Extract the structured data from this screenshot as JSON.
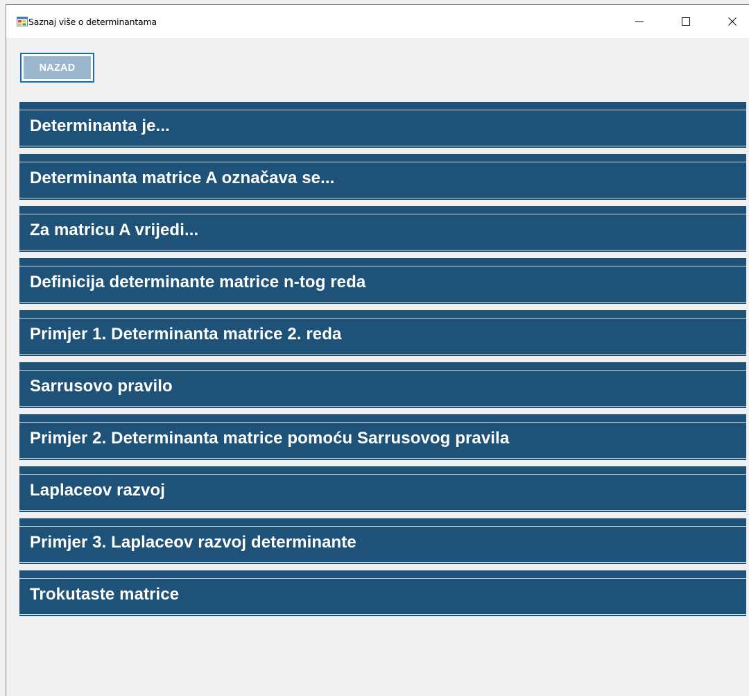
{
  "window": {
    "title": "Saznaj više o determinantama",
    "controls": {
      "minimize_icon": "minimize-icon",
      "maximize_icon": "maximize-icon",
      "close_icon": "close-icon"
    }
  },
  "toolbar": {
    "back_label": "NAZAD"
  },
  "topics": [
    {
      "label": "Determinanta je..."
    },
    {
      "label": "Determinanta matrice A označava se..."
    },
    {
      "label": "Za matricu A vrijedi..."
    },
    {
      "label": "Definicija determinante matrice n-tog reda"
    },
    {
      "label": "Primjer 1. Determinanta matrice 2. reda"
    },
    {
      "label": "Sarrusovo pravilo"
    },
    {
      "label": "Primjer 2. Determinanta matrice pomoću Sarrusovog pravila"
    },
    {
      "label": "Laplaceov razvoj"
    },
    {
      "label": "Primjer 3. Laplaceov razvoj determinante"
    },
    {
      "label": "Trokutaste matrice"
    }
  ],
  "colors": {
    "topic_background": "#1f5279",
    "topic_text": "#ffffff",
    "back_button_fill": "#9cb6cd",
    "back_button_border": "#0b6fc9",
    "window_background": "#f0f0f0"
  }
}
